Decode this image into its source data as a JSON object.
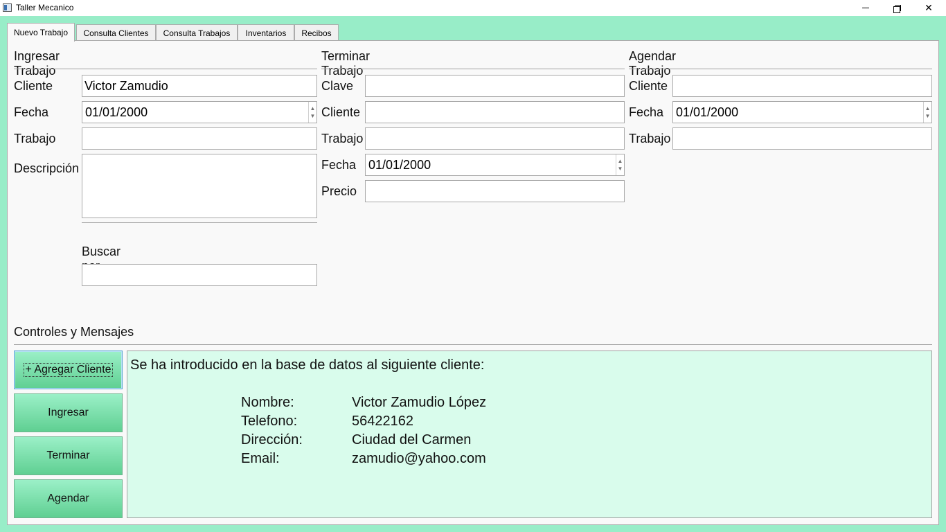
{
  "window": {
    "title": "Taller Mecanico",
    "buttons": {
      "minimize_icon": "minimize-icon",
      "maximize_icon": "restore-icon",
      "close_icon": "close-icon",
      "close_glyph": "✕"
    }
  },
  "tabs": [
    {
      "label": "Nuevo Trabajo",
      "active": true
    },
    {
      "label": "Consulta Clientes",
      "active": false
    },
    {
      "label": "Consulta Trabajos",
      "active": false
    },
    {
      "label": "Inventarios",
      "active": false
    },
    {
      "label": "Recibos",
      "active": false
    }
  ],
  "ingresar": {
    "title": "Ingresar Trabajo",
    "cliente_label": "Cliente",
    "cliente_value": "Victor Zamudio",
    "fecha_label": "Fecha",
    "fecha_value": "01/01/2000",
    "trabajo_label": "Trabajo",
    "trabajo_value": "",
    "descripcion_label": "Descripción",
    "descripcion_value": "",
    "buscar_label": "Buscar por Clave",
    "buscar_value": ""
  },
  "terminar": {
    "title": "Terminar Trabajo",
    "clave_label": "Clave",
    "clave_value": "",
    "cliente_label": "Cliente",
    "cliente_value": "",
    "trabajo_label": "Trabajo",
    "trabajo_value": "",
    "fecha_label": "Fecha",
    "fecha_value": "01/01/2000",
    "precio_label": "Precio",
    "precio_value": ""
  },
  "agendar": {
    "title": "Agendar Trabajo",
    "cliente_label": "Cliente",
    "cliente_value": "",
    "fecha_label": "Fecha",
    "fecha_value": "01/01/2000",
    "trabajo_label": "Trabajo",
    "trabajo_value": ""
  },
  "controles": {
    "title": "Controles y Mensajes",
    "buttons": {
      "agregar_cliente": "+ Agregar Cliente",
      "ingresar": "Ingresar",
      "terminar": "Terminar",
      "agendar": "Agendar"
    },
    "message": {
      "intro": "Se ha introducido en la base de datos al siguiente cliente:",
      "rows": [
        {
          "label": "Nombre:",
          "value": "Victor Zamudio López"
        },
        {
          "label": "Telefono:",
          "value": "56422162"
        },
        {
          "label": "Dirección:",
          "value": "Ciudad del Carmen"
        },
        {
          "label": "Email:",
          "value": "zamudio@yahoo.com"
        }
      ]
    }
  },
  "colors": {
    "background": "#98edc8",
    "panel": "#f9f9f9",
    "message_bg": "#d9fcec",
    "button_top": "#9bf0c8",
    "button_bottom": "#5fcf92"
  }
}
